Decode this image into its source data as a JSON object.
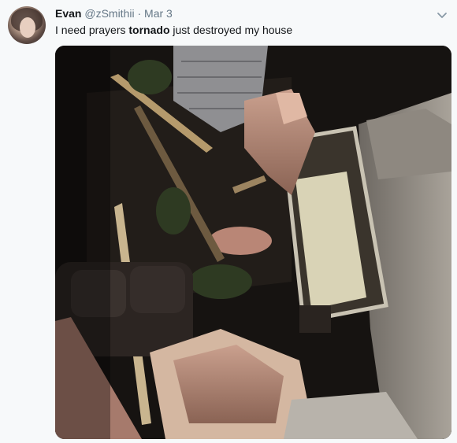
{
  "tweet": {
    "author_name": "Evan",
    "author_handle": "@zSmithii",
    "separator": "·",
    "date": "Mar 3",
    "text_before": "I need prayers ",
    "text_bold": "tornado",
    "text_after": " just destroyed my house",
    "photo": "tornado-damage-photo",
    "menu_icon": "chevron-down-icon"
  }
}
